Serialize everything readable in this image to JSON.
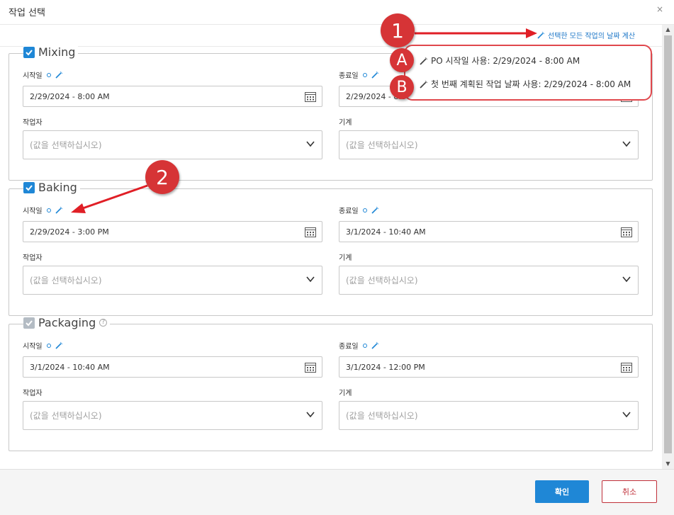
{
  "dialog": {
    "title": "작업 선택",
    "close_glyph": "×"
  },
  "toolbar": {
    "calc_all_label": "선택한 모든 작업의 날짜 계산"
  },
  "labels": {
    "start": "시작일",
    "end": "종료일",
    "operator": "작업자",
    "machine": "기계",
    "select_placeholder": "(값을 선택하십시오)"
  },
  "sections": [
    {
      "name": "Mixing",
      "checked": true,
      "start_value": "2/29/2024 - 8:00 AM",
      "end_value": "2/29/2024 - 8:00 AM"
    },
    {
      "name": "Baking",
      "checked": true,
      "start_value": "2/29/2024 - 3:00 PM",
      "end_value": "3/1/2024 - 10:40 AM"
    },
    {
      "name": "Packaging",
      "checked": false,
      "start_value": "3/1/2024 - 10:40 AM",
      "end_value": "3/1/2024 - 12:00 PM"
    }
  ],
  "popup": {
    "option_a": "PO 시작일 사용: 2/29/2024 - 8:00 AM",
    "option_b": "첫 번째 계획된 작업 날짜 사용: 2/29/2024 - 8:00 AM"
  },
  "markers": {
    "m1": "1",
    "m2": "2",
    "mA": "A",
    "mB": "B"
  },
  "footer": {
    "ok_label": "확인",
    "cancel_label": "취소"
  },
  "colors": {
    "accent": "#1f87d6",
    "annotation_red": "#d63436",
    "cancel_red": "#c0303a",
    "disabled_checkbox": "#b4bcc4"
  }
}
